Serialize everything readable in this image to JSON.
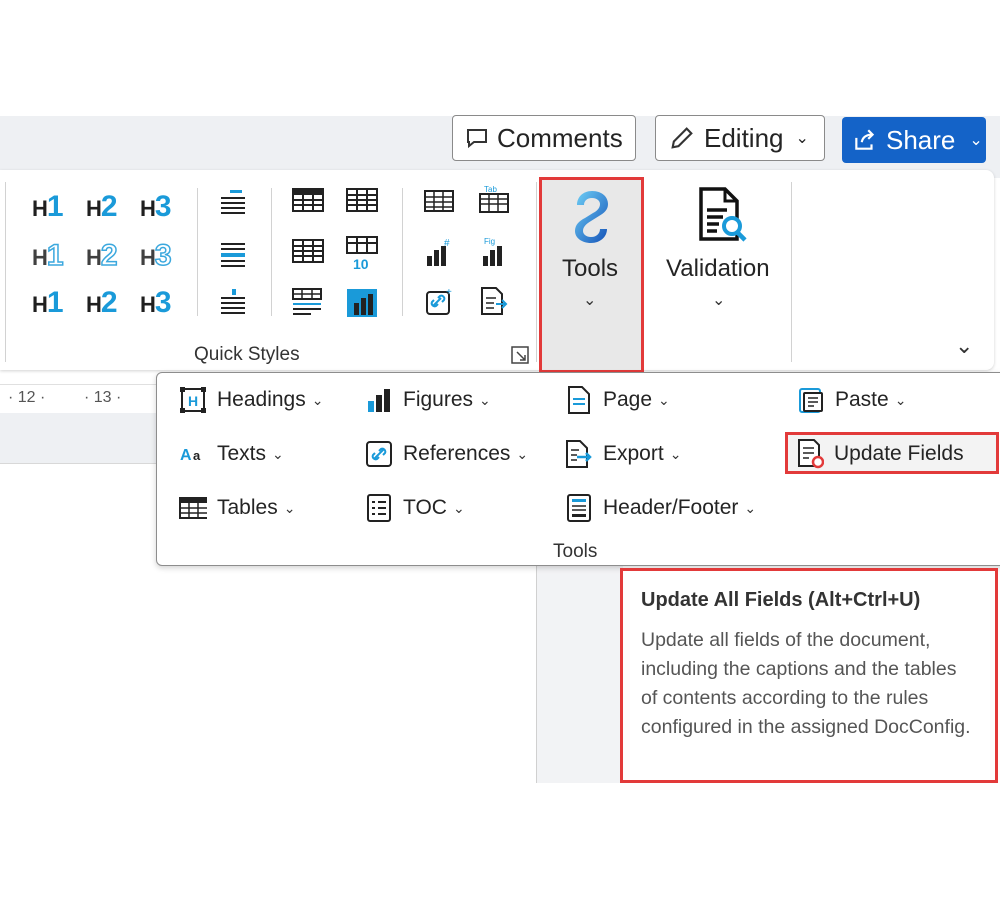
{
  "topbar": {
    "comments_label": "Comments",
    "editing_label": "Editing",
    "share_label": "Share"
  },
  "ribbon": {
    "quick_styles_label": "Quick Styles",
    "headings": [
      {
        "h": "H",
        "n": "1"
      },
      {
        "h": "H",
        "n": "2"
      },
      {
        "h": "H",
        "n": "3"
      }
    ],
    "tools_label": "Tools",
    "validation_label": "Validation"
  },
  "ruler": {
    "marks": [
      "· 12 ·",
      "· 13 ·"
    ]
  },
  "dropdown": {
    "group_label": "Tools",
    "items": [
      {
        "label": "Headings",
        "icon": "heading-icon"
      },
      {
        "label": "Texts",
        "icon": "text-icon"
      },
      {
        "label": "Tables",
        "icon": "table-icon"
      },
      {
        "label": "Figures",
        "icon": "figure-icon"
      },
      {
        "label": "References",
        "icon": "link-icon"
      },
      {
        "label": "TOC",
        "icon": "toc-icon"
      },
      {
        "label": "Page",
        "icon": "page-icon"
      },
      {
        "label": "Export",
        "icon": "export-icon"
      },
      {
        "label": "Header/Footer",
        "icon": "header-footer-icon"
      },
      {
        "label": "Paste",
        "icon": "paste-icon"
      },
      {
        "label": "Update Fields",
        "icon": "update-fields-icon"
      }
    ]
  },
  "tooltip": {
    "title": "Update All Fields (Alt+Ctrl+U)",
    "body": "Update all fields of the document, including the captions and the tables of contents according to the rules configured in the assigned DocConfig."
  },
  "colors": {
    "accent": "#1a9ad9",
    "share_bg": "#1463c8",
    "highlight_red": "#e23a3a"
  }
}
